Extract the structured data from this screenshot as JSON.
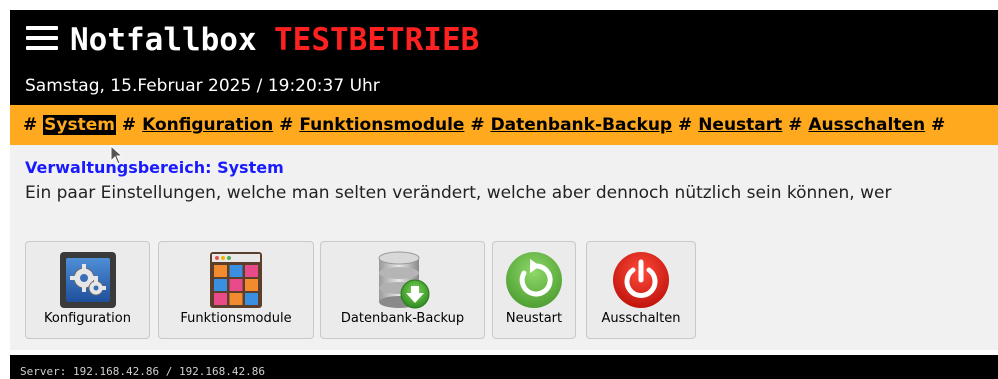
{
  "header": {
    "title": "Notfallbox",
    "mode": "TESTBETRIEB",
    "datetime": "Samstag, 15.Februar 2025 / 19:20:37 Uhr"
  },
  "nav": {
    "separator": "#",
    "items": [
      {
        "label": "System",
        "active": true
      },
      {
        "label": "Konfiguration"
      },
      {
        "label": "Funktionsmodule"
      },
      {
        "label": "Datenbank-Backup"
      },
      {
        "label": "Neustart"
      },
      {
        "label": "Ausschalten"
      }
    ]
  },
  "section": {
    "title": "Verwaltungsbereich: System",
    "description": "Ein paar Einstellungen, welche man selten verändert, welche aber dennoch nützlich sein können, wer"
  },
  "tiles": [
    {
      "label": "Konfiguration",
      "icon": "gear-config-icon"
    },
    {
      "label": "Funktionsmodule",
      "icon": "module-grid-icon"
    },
    {
      "label": "Datenbank-Backup",
      "icon": "database-backup-icon"
    },
    {
      "label": "Neustart",
      "icon": "restart-icon"
    },
    {
      "label": "Ausschalten",
      "icon": "power-icon"
    }
  ],
  "footer": {
    "server": "Server: 192.168.42.86 / 192.168.42.86"
  },
  "colors": {
    "header_bg": "#000000",
    "mode_red": "#ff2020",
    "nav_bg": "#ffa91f",
    "section_title_blue": "#1a1aff",
    "restart_green": "#6cc04a",
    "power_red": "#e2231a"
  }
}
